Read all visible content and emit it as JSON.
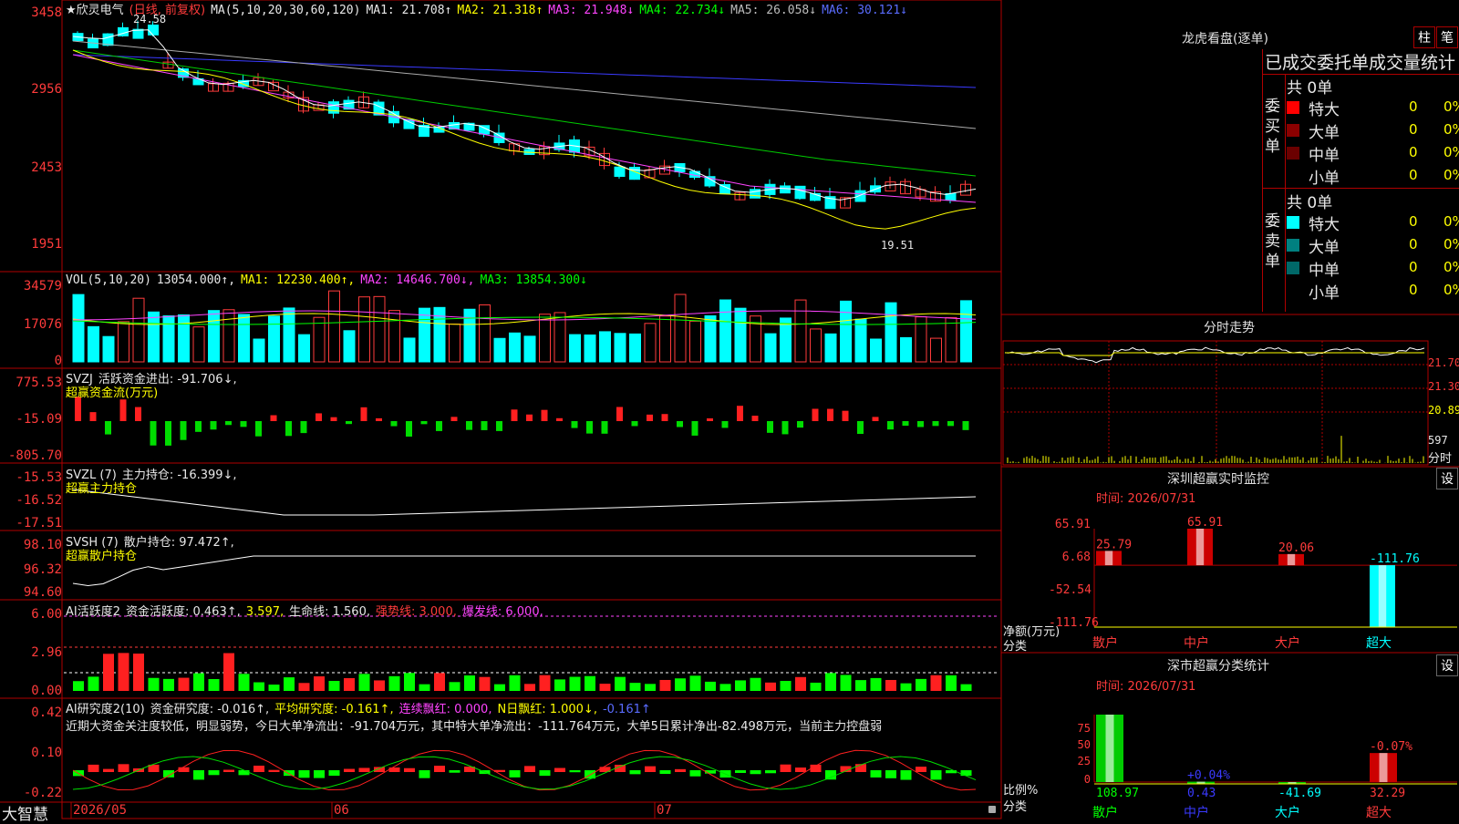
{
  "app": {
    "brand": "大智慧"
  },
  "stock": {
    "title": "★欣灵电气",
    "period": "(日线, 前复权)"
  },
  "main": {
    "ma_header": "MA(5,10,20,30,60,120)",
    "ma": [
      {
        "label": "MA1: 21.708↑",
        "color": "#e8e8e8"
      },
      {
        "label": "MA2: 21.318↑",
        "color": "#ffff00"
      },
      {
        "label": "MA3: 21.948↓",
        "color": "#ff44ff"
      },
      {
        "label": "MA4: 22.734↓",
        "color": "#00ff00"
      },
      {
        "label": "MA5: 26.058↓",
        "color": "#bcbcbc"
      },
      {
        "label": "MA6: 30.121↓",
        "color": "#5a6cff"
      }
    ],
    "y_labels": [
      "3458",
      "2956",
      "2453",
      "1951"
    ],
    "high_marker": "24.58",
    "low_marker": "19.51"
  },
  "vol": {
    "header": "VOL(5,10,20)",
    "value": "13054.000↑,",
    "ma1": "MA1: 12230.400↑,",
    "ma2": "MA2: 14646.700↓,",
    "ma3": "MA3: 13854.300↓",
    "y_labels": [
      "34579",
      "17076",
      "0"
    ]
  },
  "svzj": {
    "header": "SVZJ",
    "line": "活跃资金进出: -91.706↓,",
    "sub": "超赢资金流(万元)",
    "y_labels": [
      "775.53",
      "-15.09",
      "-805.70"
    ]
  },
  "svzl": {
    "header": "SVZL (7)",
    "line": "主力持仓: -16.399↓,",
    "sub": "超赢主力持仓",
    "y_labels": [
      "-15.53",
      "-16.52",
      "-17.51"
    ]
  },
  "svsh": {
    "header": "SVSH (7)",
    "line": "散户持仓: 97.472↑,",
    "sub": "超赢散户持仓",
    "y_labels": [
      "98.10",
      "96.32",
      "94.60"
    ]
  },
  "ai1": {
    "header": "AI活跃度2",
    "line1": "资金活跃度: 0.463↑,",
    "line2": "3.597,",
    "line3": "生命线: 1.560,",
    "line4": "强势线: 3.000,",
    "line5": "爆发线: 6.000,",
    "y_labels": [
      "6.00",
      "2.96",
      "0.00"
    ]
  },
  "ai2": {
    "header": "AI研究度2(10)",
    "line1": "资金研究度: -0.016↑,",
    "line2": "平均研究度: -0.161↑,",
    "line3": "连续飘红: 0.000,",
    "line4": "N日飘红: 1.000↓,",
    "line5": "-0.161↑",
    "comment": "近期大资金关注度较低，明显弱势，今日大单净流出：-91.704万元，其中特大单净流出：-111.764万元，大单5日累计净出-82.498万元，当前主力控盘弱",
    "y_labels": [
      "0.42",
      "0.10",
      "-0.22"
    ]
  },
  "x_axis": {
    "labels": [
      "2026/05",
      "06",
      "07"
    ]
  },
  "right": {
    "lhb_title": "龙虎看盘(逐单)",
    "btn_bar": "柱",
    "btn_line": "笔",
    "stat_title": "已成交委托单成交量统计",
    "buy_label": "委买单",
    "sell_label": "委卖单",
    "buy_total": "共 0单",
    "sell_total": "共 0单",
    "buy_rows": [
      {
        "name": "特大",
        "count": "0",
        "pct": "0%",
        "color": "#ff0000"
      },
      {
        "name": "大单",
        "count": "0",
        "pct": "0%",
        "color": "#8b0000"
      },
      {
        "name": "中单",
        "count": "0",
        "pct": "0%",
        "color": "#6b0000"
      },
      {
        "name": "小单",
        "count": "0",
        "pct": "0%",
        "color": "#000000"
      }
    ],
    "sell_rows": [
      {
        "name": "特大",
        "count": "0",
        "pct": "0%",
        "color": "#00ffff"
      },
      {
        "name": "大单",
        "count": "0",
        "pct": "0%",
        "color": "#008080"
      },
      {
        "name": "中单",
        "count": "0",
        "pct": "0%",
        "color": "#006868"
      },
      {
        "name": "小单",
        "count": "0",
        "pct": "0%",
        "color": "#000000"
      }
    ],
    "intraday_title": "分时走势",
    "intraday_y": [
      "21.70",
      "21.30",
      "20.89",
      "597",
      "分时"
    ],
    "monitor_title": "深圳超赢实时监控",
    "monitor_set": "设",
    "monitor_time": "时间: 2026/07/31",
    "monitor_y": [
      "65.91",
      "6.68",
      "-52.54",
      "-111.76"
    ],
    "monitor_unit": "净额(万元)",
    "monitor_cat": "分类",
    "classify_title": "深市超赢分类统计",
    "classify_set": "设",
    "classify_time": "时间: 2026/07/31",
    "classify_y": [
      "75",
      "50",
      "25",
      "0"
    ],
    "classify_unit": "比例%",
    "classify_cat": "分类"
  },
  "chart_data": [
    {
      "type": "bar",
      "title": "深圳超赢实时监控",
      "ylabel": "净额(万元)",
      "categories": [
        "散户",
        "中户",
        "大户",
        "超大"
      ],
      "values": [
        25.79,
        65.91,
        20.06,
        -111.76
      ],
      "ylim": [
        -111.76,
        65.91
      ]
    },
    {
      "type": "bar",
      "title": "深市超赢分类统计",
      "ylabel": "比例%",
      "categories": [
        "散户",
        "中户",
        "大户",
        "超大"
      ],
      "values": [
        108.97,
        0.43,
        -41.69,
        32.29
      ],
      "top_labels": [
        "",
        "+0.04%",
        "",
        "-0.07%"
      ],
      "ylim": [
        0,
        75
      ]
    }
  ]
}
